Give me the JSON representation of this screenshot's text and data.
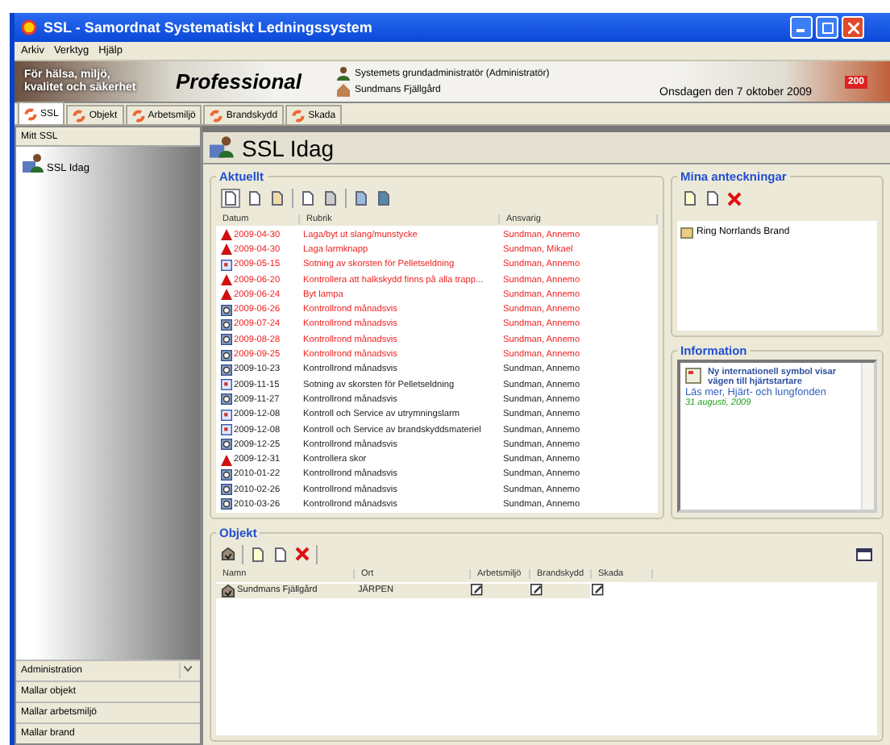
{
  "window": {
    "title": "SSL - Samordnat Systematiskt Ledningssystem"
  },
  "menu": [
    "Arkiv",
    "Verktyg",
    "Hjälp"
  ],
  "banner": {
    "slogan_lines": [
      "För hälsa, miljö,",
      "kvalitet och säkerhet"
    ],
    "edition": "Professional",
    "user": "Systemets grundadministratör (Administratör)",
    "object": "Sundmans Fjällgård",
    "date": "Onsdagen den 7 oktober 2009",
    "ribbon": "200"
  },
  "tabs": [
    {
      "label": "SSL",
      "selected": true
    },
    {
      "label": "Objekt",
      "selected": false
    },
    {
      "label": "Arbetsmiljö",
      "selected": false
    },
    {
      "label": "Brandskydd",
      "selected": false
    },
    {
      "label": "Skada",
      "selected": false
    }
  ],
  "sidebar": {
    "header": "Mitt SSL",
    "items": [
      {
        "label": "SSL Idag"
      }
    ],
    "sections": [
      {
        "label": "Administration",
        "expander": true
      },
      {
        "label": "Mallar objekt",
        "expander": false
      },
      {
        "label": "Mallar arbetsmiljö",
        "expander": false
      },
      {
        "label": "Mallar brand",
        "expander": false
      }
    ]
  },
  "page_title": "SSL Idag",
  "aktuellt": {
    "title": "Aktuellt",
    "columns": [
      "Datum",
      "Rubrik",
      "Ansvarig"
    ],
    "rows": [
      {
        "kind": "warning",
        "date": "2009-04-30",
        "rubrik": "Laga/byt ut slang/munstycke",
        "ansvarig": "Sundman, Annemo",
        "overdue": true
      },
      {
        "kind": "warning",
        "date": "2009-04-30",
        "rubrik": "Laga larmknapp",
        "ansvarig": "Sundman, Mikael",
        "overdue": true
      },
      {
        "kind": "calendar",
        "date": "2009-05-15",
        "rubrik": "Sotning av skorsten för Pelletseldning",
        "ansvarig": "Sundman, Annemo",
        "overdue": true
      },
      {
        "kind": "warning",
        "date": "2009-06-20",
        "rubrik": "Kontrollera att halkskydd finns på alla trapp...",
        "ansvarig": "Sundman, Annemo",
        "overdue": true
      },
      {
        "kind": "warning",
        "date": "2009-06-24",
        "rubrik": "Byt lampa",
        "ansvarig": "Sundman, Annemo",
        "overdue": true
      },
      {
        "kind": "round",
        "date": "2009-06-26",
        "rubrik": "Kontrollrond månadsvis",
        "ansvarig": "Sundman, Annemo",
        "overdue": true
      },
      {
        "kind": "round",
        "date": "2009-07-24",
        "rubrik": "Kontrollrond månadsvis",
        "ansvarig": "Sundman, Annemo",
        "overdue": true
      },
      {
        "kind": "round",
        "date": "2009-08-28",
        "rubrik": "Kontrollrond månadsvis",
        "ansvarig": "Sundman, Annemo",
        "overdue": true
      },
      {
        "kind": "round",
        "date": "2009-09-25",
        "rubrik": "Kontrollrond månadsvis",
        "ansvarig": "Sundman, Annemo",
        "overdue": true
      },
      {
        "kind": "round",
        "date": "2009-10-23",
        "rubrik": "Kontrollrond månadsvis",
        "ansvarig": "Sundman, Annemo",
        "overdue": false
      },
      {
        "kind": "calendar",
        "date": "2009-11-15",
        "rubrik": "Sotning av skorsten för Pelletseldning",
        "ansvarig": "Sundman, Annemo",
        "overdue": false
      },
      {
        "kind": "round",
        "date": "2009-11-27",
        "rubrik": "Kontrollrond månadsvis",
        "ansvarig": "Sundman, Annemo",
        "overdue": false
      },
      {
        "kind": "calendar",
        "date": "2009-12-08",
        "rubrik": "Kontroll och Service av utrymningslarm",
        "ansvarig": "Sundman, Annemo",
        "overdue": false
      },
      {
        "kind": "calendar",
        "date": "2009-12-08",
        "rubrik": "Kontroll och Service av brandskyddsmateriel",
        "ansvarig": "Sundman, Annemo",
        "overdue": false
      },
      {
        "kind": "round",
        "date": "2009-12-25",
        "rubrik": "Kontrollrond månadsvis",
        "ansvarig": "Sundman, Annemo",
        "overdue": false
      },
      {
        "kind": "warning",
        "date": "2009-12-31",
        "rubrik": "Kontrollera skor",
        "ansvarig": "Sundman, Annemo",
        "overdue": false
      },
      {
        "kind": "round",
        "date": "2010-01-22",
        "rubrik": "Kontrollrond månadsvis",
        "ansvarig": "Sundman, Annemo",
        "overdue": false
      },
      {
        "kind": "round",
        "date": "2010-02-26",
        "rubrik": "Kontrollrond månadsvis",
        "ansvarig": "Sundman, Annemo",
        "overdue": false
      },
      {
        "kind": "round",
        "date": "2010-03-26",
        "rubrik": "Kontrollrond månadsvis",
        "ansvarig": "Sundman, Annemo",
        "overdue": false
      }
    ]
  },
  "notes": {
    "title": "Mina anteckningar",
    "items": [
      "Ring Norrlands Brand"
    ]
  },
  "information": {
    "title": "Information",
    "items": [
      {
        "headline": "Ny internationell symbol visar vägen till hjärtstartare",
        "link": "Läs mer, Hjärt- och lungfonden",
        "date": "31 augusti, 2009"
      }
    ]
  },
  "objekt": {
    "title": "Objekt",
    "columns": [
      "Namn",
      "Ort",
      "Arbetsmiljö",
      "Brandskydd",
      "Skada"
    ],
    "rows": [
      {
        "name": "Sundmans Fjällgård",
        "ort": "JÄRPEN"
      }
    ]
  }
}
